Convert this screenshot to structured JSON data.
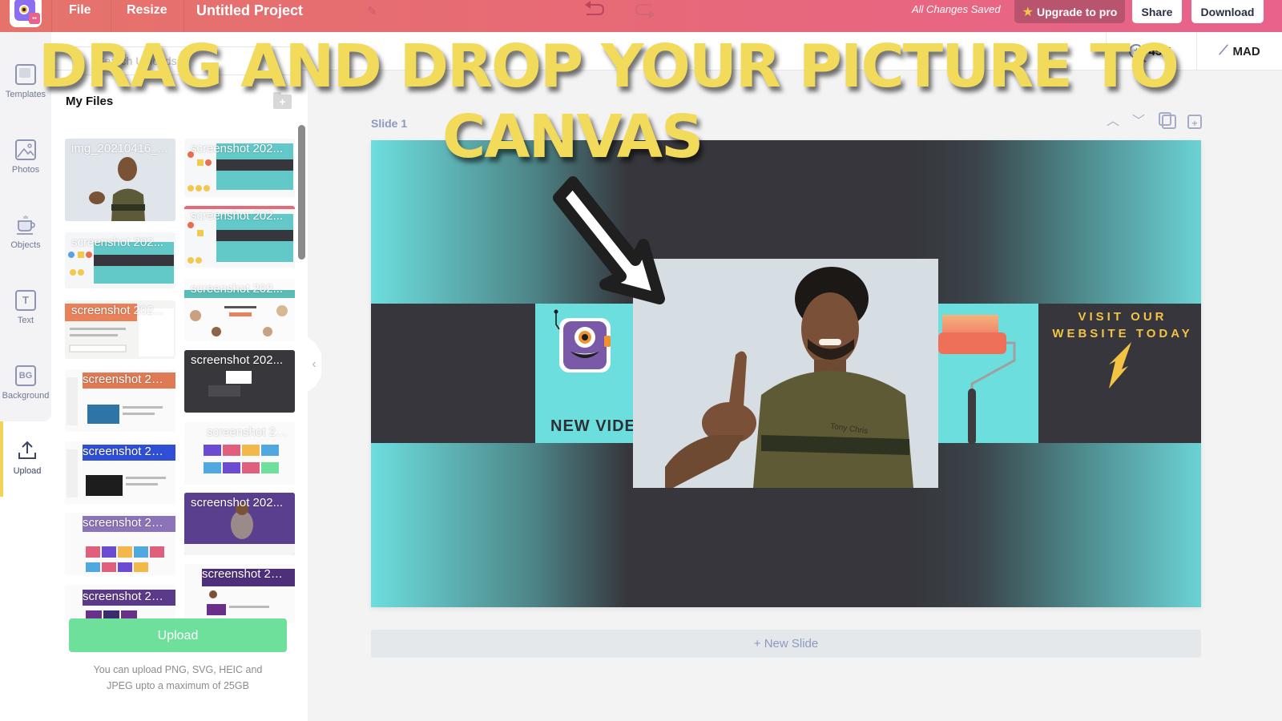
{
  "topbar": {
    "logo": "app-logo",
    "file_label": "File",
    "resize_label": "Resize",
    "project_title": "Untitled Project",
    "save_status": "All Changes Saved",
    "upgrade_label": "Upgrade to pro",
    "share_label": "Share",
    "download_label": "Download",
    "icons": [
      "pencil-icon",
      "undo-icon",
      "redo-icon",
      "star-icon"
    ]
  },
  "subbar": {
    "search_placeholder": "Search Uploads",
    "zoom_level": "45%",
    "magic_label": "MAD"
  },
  "leftnav": {
    "items": [
      {
        "label": "Templates",
        "icon": "templates-icon",
        "glyph": ""
      },
      {
        "label": "Photos",
        "icon": "photos-icon",
        "glyph": ""
      },
      {
        "label": "Objects",
        "icon": "objects-icon",
        "glyph": ""
      },
      {
        "label": "Text",
        "icon": "text-icon",
        "glyph": "T"
      },
      {
        "label": "Background",
        "icon": "background-icon",
        "glyph": "BG"
      },
      {
        "label": "Upload",
        "icon": "upload-icon",
        "glyph": "⇧",
        "active": true
      }
    ]
  },
  "panel": {
    "title": "My Files",
    "files": [
      {
        "name": "img_20210416_..."
      },
      {
        "name": "screenshot 202..."
      },
      {
        "name": "screenshot 202..."
      },
      {
        "name": "screenshot 202..."
      },
      {
        "name": "screenshot 202..."
      },
      {
        "name": "screenshot 202..."
      },
      {
        "name": "screenshot 202..."
      },
      {
        "name": "screenshot 202..."
      },
      {
        "name": "screenshot 202..."
      },
      {
        "name": "screenshot 202..."
      },
      {
        "name": "screenshot 202..."
      },
      {
        "name": "screenshot 202..."
      },
      {
        "name": "screenshot 202..."
      },
      {
        "name": "screenshot 202..."
      }
    ],
    "upload_button": "Upload",
    "upload_note_line1": "You can upload PNG, SVG, HEIC and",
    "upload_note_line2": "JPEG upto a maximum of 25GB"
  },
  "canvas": {
    "slide_label": "Slide 1",
    "new_video_text": "NEW VIDEO",
    "visit_line1": "VISIT OUR",
    "visit_line2": "WEBSITE TODAY",
    "shirt_text": "Tony Chris",
    "new_slide_label": "+ New Slide",
    "tools": [
      "move-up-icon",
      "move-down-icon",
      "duplicate-slide-icon",
      "add-slide-icon"
    ]
  },
  "overlay": {
    "line1": "DRAG AND DROP YOUR PICTURE TO",
    "line2": "CANVAS"
  },
  "colors": {
    "topbar_start": "#e5736a",
    "topbar_end": "#e8628c",
    "upgrade_bg": "#b9546f",
    "upload_green": "#6fdf9c",
    "accent_yellow": "#f2da5b",
    "slide_cyan": "#6ddede",
    "slide_dark": "#36363c",
    "slide_label": "#8f98bd"
  }
}
